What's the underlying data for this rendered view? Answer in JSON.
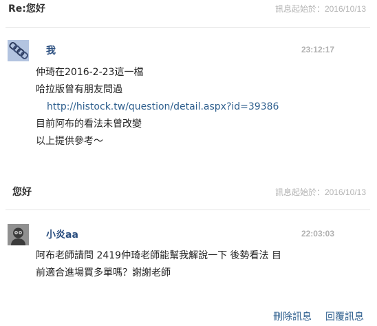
{
  "threads": [
    {
      "title": "Re:您好",
      "date": "訊息起始於：2016/10/13",
      "message": {
        "sender": "我",
        "time": "23:12:17",
        "avatar_icon": "chain-link-icon",
        "lines": [
          "仲琦在2016-2-23這一檔",
          "哈拉版曾有朋友問過"
        ],
        "link": "http://histock.tw/question/detail.aspx?id=39386",
        "lines_after": [
          "目前阿布的看法未曾改變",
          "以上提供參考～"
        ]
      }
    },
    {
      "title": "您好",
      "date": "訊息起始於：2016/10/13",
      "message": {
        "sender": "小炎aa",
        "time": "22:03:03",
        "avatar_icon": "default-avatar-icon",
        "lines": [
          "阿布老師請問 2419仲琦老師能幫我解說一下 後勢看法 目",
          "前適合進場買多單嗎？謝謝老師"
        ]
      }
    }
  ],
  "actions": {
    "delete_label": "刪除訊息",
    "reply_label": "回覆訊息"
  },
  "colors": {
    "link": "#2e5f8e",
    "sender": "#2a4e7f",
    "muted": "#b3b3b3",
    "divider": "#e3e3e3"
  }
}
